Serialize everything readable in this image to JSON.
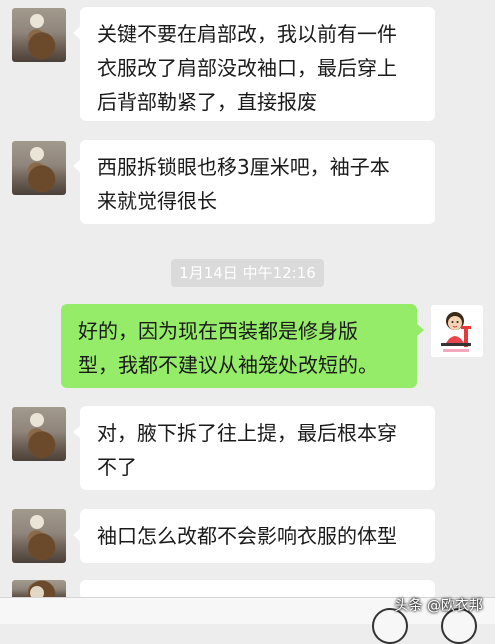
{
  "messages": [
    {
      "sender": "other",
      "lines": [
        "关键不要在肩部改，我以前有一件",
        "衣服改了肩部没改袖口，最后穿上",
        "后背部勒紧了，直接报废"
      ]
    },
    {
      "sender": "other",
      "lines": [
        "西服拆锁眼也移3厘米吧，袖子本",
        "来就觉得很长"
      ]
    },
    {
      "sender": "me",
      "lines": [
        "好的，因为现在西装都是修身版",
        "型，我都不建议从袖笼处改短的。"
      ]
    },
    {
      "sender": "other",
      "lines": [
        "对，腋下拆了往上提，最后根本穿",
        "不了"
      ]
    },
    {
      "sender": "other",
      "lines": [
        "袖口怎么改都不会影响衣服的体型"
      ]
    }
  ],
  "timestamp": "1月14日 中午12:16",
  "watermark": "头条 @欧衣邦",
  "colors": {
    "my_bubble": "#95ec69",
    "other_bubble": "#ffffff",
    "background": "#ededed"
  }
}
